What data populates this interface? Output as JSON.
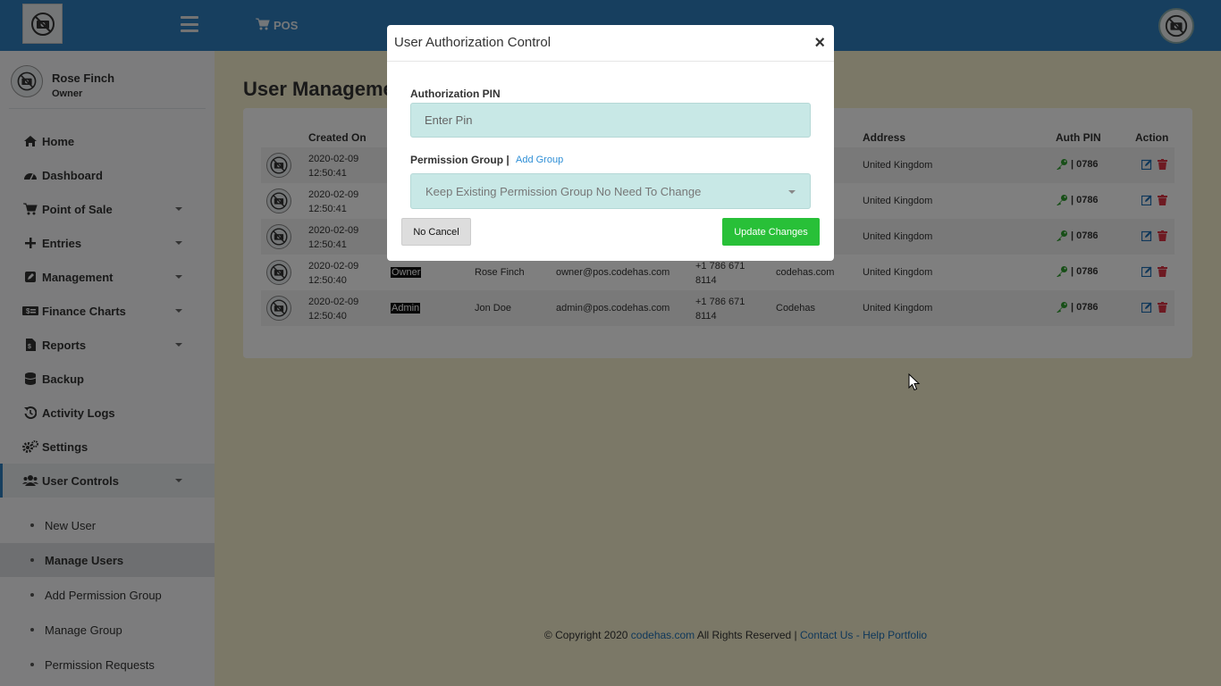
{
  "sidebar": {
    "user": {
      "name": "Rose Finch",
      "role": "Owner"
    },
    "nav": [
      {
        "label": "Home",
        "icon": "home-icon"
      },
      {
        "label": "Dashboard",
        "icon": "dashboard-icon"
      },
      {
        "label": "Point of Sale",
        "icon": "cart-icon"
      },
      {
        "label": "Entries",
        "icon": "plus-icon"
      },
      {
        "label": "Management",
        "icon": "edit-icon"
      },
      {
        "label": "Finance Charts",
        "icon": "money-icon"
      },
      {
        "label": "Reports",
        "icon": "file-icon"
      },
      {
        "label": "Backup",
        "icon": "database-icon"
      },
      {
        "label": "Activity Logs",
        "icon": "history-icon"
      },
      {
        "label": "Settings",
        "icon": "cogs-icon"
      },
      {
        "label": "User Controls",
        "icon": "users-icon"
      }
    ],
    "sub_items": [
      {
        "label": "New User"
      },
      {
        "label": "Manage Users"
      },
      {
        "label": "Add Permission Group"
      },
      {
        "label": "Manage Group"
      },
      {
        "label": "Permission Requests"
      }
    ]
  },
  "topbar": {
    "pos_label": "POS"
  },
  "page": {
    "title": "User Manageme"
  },
  "table": {
    "columns": {
      "created_on": "Created On",
      "address": "Address",
      "auth_pin": "Auth PIN",
      "action": "Action"
    },
    "rows": [
      {
        "date": "2020-02-09",
        "time": "12:50:41",
        "role": "",
        "name": "",
        "email": "",
        "phone1": "",
        "phone2": "",
        "company": "",
        "address": "United Kingdom",
        "pin": "0786"
      },
      {
        "date": "2020-02-09",
        "time": "12:50:41",
        "role": "",
        "name": "",
        "email": "",
        "phone1": "",
        "phone2": "",
        "company": "",
        "address": "United Kingdom",
        "pin": "0786"
      },
      {
        "date": "2020-02-09",
        "time": "12:50:41",
        "role": "",
        "name": "",
        "email": "",
        "phone1": "",
        "phone2": "",
        "company": "",
        "address": "United Kingdom",
        "pin": "0786"
      },
      {
        "date": "2020-02-09",
        "time": "12:50:40",
        "role": "Owner",
        "name": "Rose Finch",
        "email": "owner@pos.codehas.com",
        "phone1": "+1 786 671",
        "phone2": "8114",
        "company": "codehas.com",
        "address": "United Kingdom",
        "pin": "0786"
      },
      {
        "date": "2020-02-09",
        "time": "12:50:40",
        "role": "Admin",
        "name": "Jon Doe",
        "email": "admin@pos.codehas.com",
        "phone1": "+1 786 671",
        "phone2": "8114",
        "company": "Codehas",
        "address": "United Kingdom",
        "pin": "0786"
      }
    ],
    "pin_separator": "|"
  },
  "footer": {
    "copyright": "© Copyright 2020",
    "site_link": "codehas.com",
    "rights": "All Rights Reserved |",
    "contact": "Contact Us",
    "dash": "-",
    "help": "Help Portfolio"
  },
  "modal": {
    "title": "User Authorization Control",
    "close": "×",
    "pin_label": "Authorization PIN",
    "pin_placeholder": "Enter Pin",
    "group_label": "Permission Group |",
    "add_group": "Add Group",
    "group_selected": "Keep Existing Permission Group No Need To Change",
    "cancel_label": "No Cancel",
    "update_label": "Update Changes"
  },
  "colors": {
    "primary": "#2f7fbf",
    "success": "#28c038",
    "danger": "#dc3545",
    "key_green": "#2e9e2e",
    "input_bg": "#c8e8e6"
  }
}
